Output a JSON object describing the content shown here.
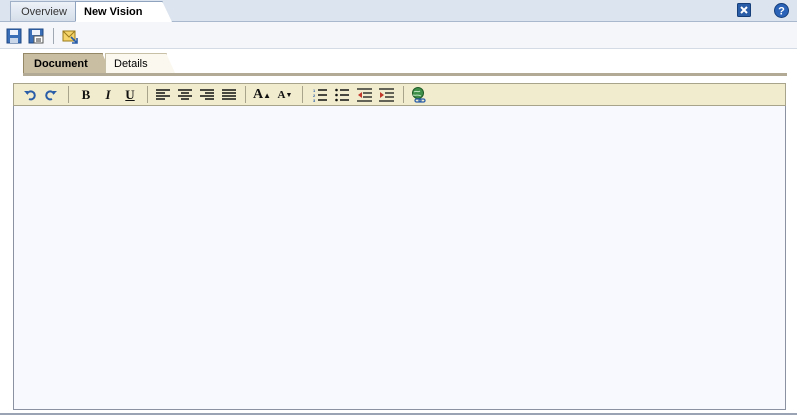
{
  "top_tabs": [
    {
      "label": "Overview"
    },
    {
      "label": "New Vision"
    }
  ],
  "window_buttons": {
    "close": "close-icon",
    "help": "help-icon"
  },
  "main_toolbar": [
    "save-icon",
    "save-as-icon",
    "send-icon"
  ],
  "sub_tabs": [
    {
      "label": "Document"
    },
    {
      "label": "Details"
    }
  ],
  "editor_toolbar": {
    "bold": "B",
    "italic": "I",
    "underline": "U",
    "font_size_up": "A",
    "font_size_down": "A"
  },
  "editor": {
    "content": ""
  },
  "colors": {
    "tab_strip": "#dce4ef",
    "active_subtab": "#c9bda2",
    "editor_toolbar": "#f1ecce",
    "editor_background": "#f8f8ff"
  }
}
